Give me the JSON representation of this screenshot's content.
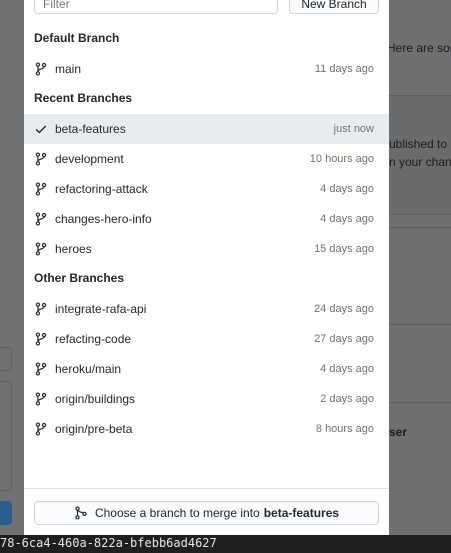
{
  "filter": {
    "placeholder": "Filter"
  },
  "new_branch_label": "New Branch",
  "sections": {
    "default": "Default Branch",
    "recent": "Recent Branches",
    "other": "Other Branches"
  },
  "default_branches": [
    {
      "name": "main",
      "time": "11 days ago"
    }
  ],
  "recent_branches": [
    {
      "name": "beta-features",
      "time": "just now",
      "selected": true
    },
    {
      "name": "development",
      "time": "10 hours ago"
    },
    {
      "name": "refactoring-attack",
      "time": "4 days ago"
    },
    {
      "name": "changes-hero-info",
      "time": "4 days ago"
    },
    {
      "name": "heroes",
      "time": "15 days ago"
    }
  ],
  "other_branches": [
    {
      "name": "integrate-rafa-api",
      "time": "24 days ago"
    },
    {
      "name": "refacting-code",
      "time": "27 days ago"
    },
    {
      "name": "heroku/main",
      "time": "4 days ago"
    },
    {
      "name": "origin/buildings",
      "time": "2 days ago"
    },
    {
      "name": "origin/pre-beta",
      "time": "8 hours ago"
    }
  ],
  "merge": {
    "prefix": "Choose a branch to merge into",
    "target": "beta-features"
  },
  "background_fragments": {
    "line1": "Here are sor",
    "line2": "ublished to",
    "line3": "n your chanc",
    "line4": "ser"
  },
  "status_bar_text": "78-6ca4-460a-822a-bfebb6ad4627"
}
